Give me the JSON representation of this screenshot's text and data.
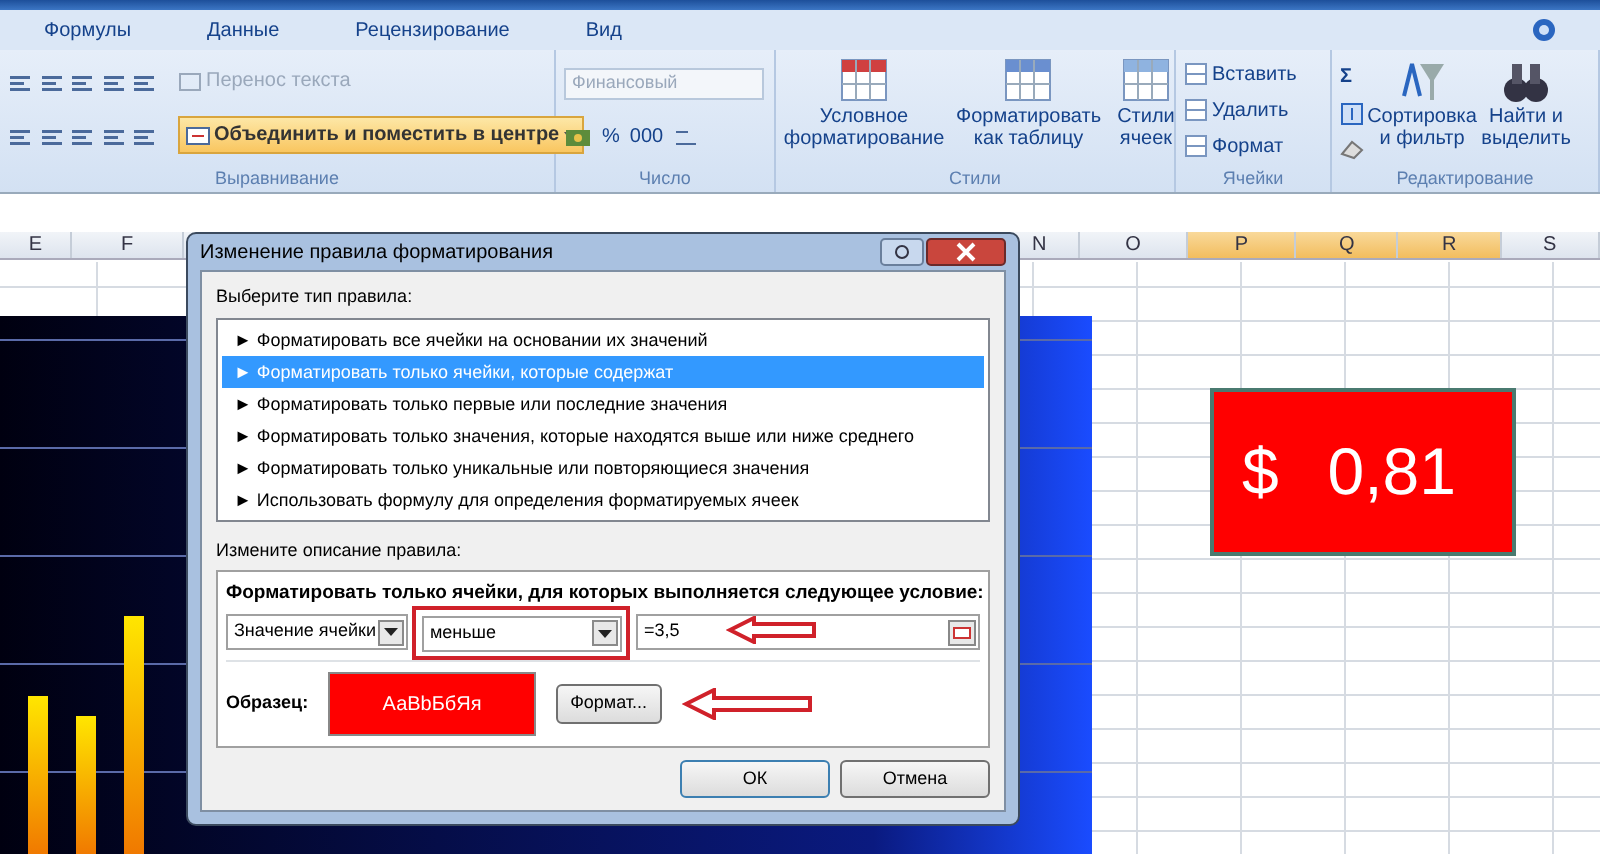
{
  "ribbon_tabs": [
    {
      "label": "Формулы"
    },
    {
      "label": "Данные"
    },
    {
      "label": "Рецензирование"
    },
    {
      "label": "Вид"
    }
  ],
  "alignment_group": {
    "wrap_text": {
      "label": "Перенос текста",
      "disabled": true
    },
    "merge": {
      "label": "Объединить и поместить в центре",
      "active": true
    },
    "label": "Выравнивание"
  },
  "number_group": {
    "format": {
      "value": "Финансовый",
      "disabled": true
    },
    "percent": "%",
    "thousands": "000",
    "label": "Число"
  },
  "styles_group": {
    "buttons": [
      {
        "label": "Условное форматирование"
      },
      {
        "label": "Форматировать как таблицу"
      },
      {
        "label": "Стили ячеек"
      }
    ],
    "label": "Стили"
  },
  "cells_group": {
    "items": [
      "Вставить",
      "Удалить",
      "Формат"
    ],
    "label": "Ячейки"
  },
  "editing_group": {
    "sum": "Σ",
    "buttons": [
      {
        "label": "Сортировка и фильтр"
      },
      {
        "label": "Найти и выделить"
      }
    ],
    "label": "Редактирование"
  },
  "columns": [
    {
      "label": "E",
      "selected": false
    },
    {
      "label": "F",
      "selected": false
    },
    {
      "label": "N",
      "selected": false
    },
    {
      "label": "O",
      "selected": false
    },
    {
      "label": "P",
      "selected": true
    },
    {
      "label": "Q",
      "selected": true
    },
    {
      "label": "R",
      "selected": true
    },
    {
      "label": "S",
      "selected": false
    }
  ],
  "merged_cell": {
    "currency": "$",
    "value": "0,81"
  },
  "dialog": {
    "title": "Изменение правила форматирования",
    "rule_type_label": "Выберите тип правила:",
    "rule_types": [
      {
        "label": "► Форматировать все ячейки на основании их значений",
        "selected": false
      },
      {
        "label": "► Форматировать только ячейки, которые содержат",
        "selected": true
      },
      {
        "label": "► Форматировать только первые или последние значения",
        "selected": false
      },
      {
        "label": "► Форматировать только значения, которые находятся выше или ниже среднего",
        "selected": false
      },
      {
        "label": "► Форматировать только уникальные или повторяющиеся значения",
        "selected": false
      },
      {
        "label": "► Использовать формулу для определения форматируемых ячеек",
        "selected": false
      }
    ],
    "description_label": "Измените описание правила:",
    "condition_heading": "Форматировать только ячейки, для которых выполняется следующее условие:",
    "subject": "Значение ячейки",
    "operator": "меньше",
    "value": "=3,5",
    "preview_label": "Образец:",
    "preview_text": "АаВbБбЯя",
    "format_button": "Формат...",
    "ok_button": "ОК",
    "cancel_button": "Отмена"
  }
}
